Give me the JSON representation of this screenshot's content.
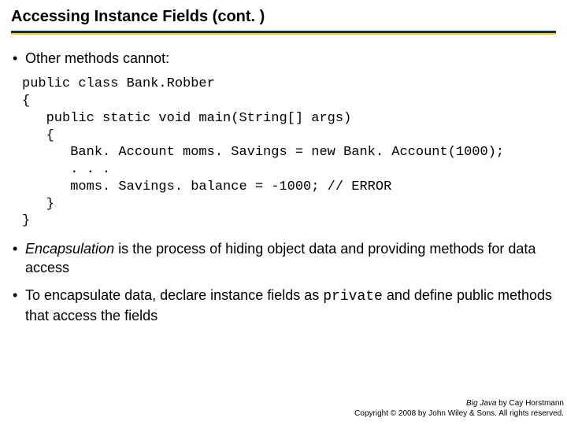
{
  "title": "Accessing Instance Fields  (cont. )",
  "bullets": {
    "b1": "Other methods cannot:",
    "b2_pre": "",
    "b2_ital": "Encapsulation",
    "b2_post": " is the process of hiding object data and providing methods for data access",
    "b3_pre": "To encapsulate data, declare instance fields as ",
    "b3_code": "private",
    "b3_post": " and define public methods that access the fields"
  },
  "code": "public class Bank.Robber\n{\n   public static void main(String[] args)\n   {\n      Bank. Account moms. Savings = new Bank. Account(1000);\n      . . .\n      moms. Savings. balance = -1000; // ERROR\n   }\n}",
  "footer": {
    "book": "Big Java",
    "by": " by Cay Horstmann",
    "copyright": "Copyright © 2008 by John Wiley & Sons.  All rights reserved."
  }
}
